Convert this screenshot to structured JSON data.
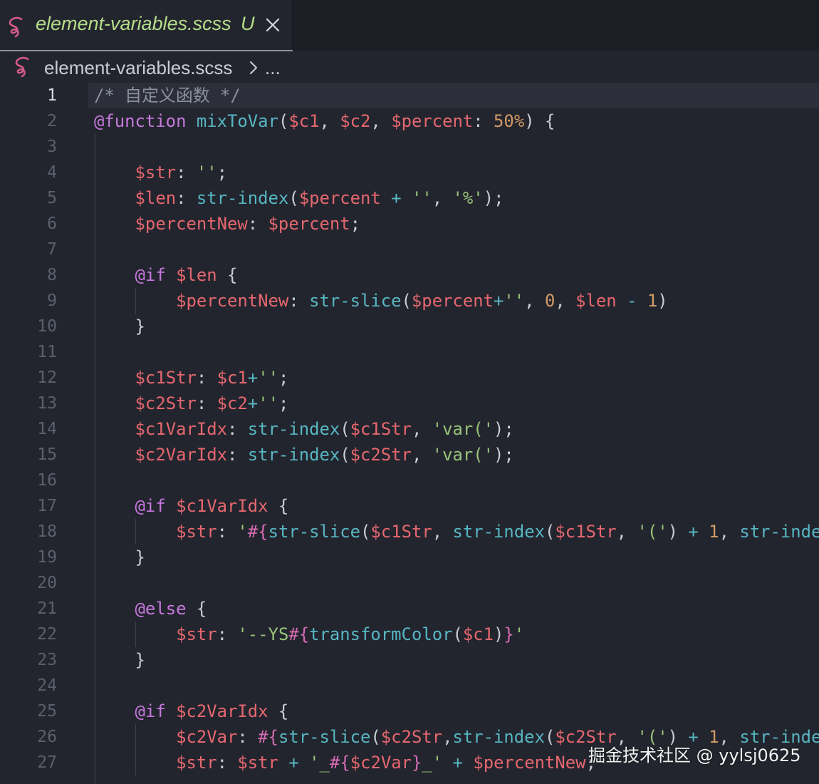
{
  "tab": {
    "icon": "sass-icon",
    "title": "element-variables.scss",
    "status": "U",
    "close_icon": "close-icon"
  },
  "breadcrumb": {
    "icon": "sass-icon",
    "file": "element-variables.scss",
    "separator_icon": "chevron-right-icon",
    "more": "..."
  },
  "editor": {
    "current_line": 1,
    "colors": {
      "background": "#23252e",
      "comment": "#8b909b",
      "keyword": "#c678dd",
      "function": "#56b6c2",
      "variable": "#e5676f",
      "number": "#d19a66",
      "string": "#98c379",
      "interpolation": "#d46bb1",
      "tab_title": "#b5dd8a",
      "sass_icon": "#d25a86"
    },
    "lines": [
      {
        "num": "1",
        "tokens": [
          [
            "comment",
            "/* 自定义函数 */"
          ]
        ]
      },
      {
        "num": "2",
        "tokens": [
          [
            "at",
            "@function"
          ],
          [
            "punc",
            " "
          ],
          [
            "fn",
            "mixToVar"
          ],
          [
            "punc",
            "("
          ],
          [
            "var",
            "$c1"
          ],
          [
            "punc",
            ", "
          ],
          [
            "var",
            "$c2"
          ],
          [
            "punc",
            ", "
          ],
          [
            "var",
            "$percent"
          ],
          [
            "punc",
            ": "
          ],
          [
            "num",
            "50%"
          ],
          [
            "punc",
            ") {"
          ]
        ]
      },
      {
        "num": "3",
        "tokens": []
      },
      {
        "num": "4",
        "tokens": [
          [
            "punc",
            "    "
          ],
          [
            "var",
            "$str"
          ],
          [
            "punc",
            ": "
          ],
          [
            "str",
            "''"
          ],
          [
            "punc",
            ";"
          ]
        ]
      },
      {
        "num": "5",
        "tokens": [
          [
            "punc",
            "    "
          ],
          [
            "var",
            "$len"
          ],
          [
            "punc",
            ": "
          ],
          [
            "fn",
            "str-index"
          ],
          [
            "punc",
            "("
          ],
          [
            "var",
            "$percent"
          ],
          [
            "punc",
            " "
          ],
          [
            "op",
            "+"
          ],
          [
            "punc",
            " "
          ],
          [
            "str",
            "''"
          ],
          [
            "punc",
            ", "
          ],
          [
            "str",
            "'%'"
          ],
          [
            "punc",
            ");"
          ]
        ]
      },
      {
        "num": "6",
        "tokens": [
          [
            "punc",
            "    "
          ],
          [
            "var",
            "$percentNew"
          ],
          [
            "punc",
            ": "
          ],
          [
            "var",
            "$percent"
          ],
          [
            "punc",
            ";"
          ]
        ]
      },
      {
        "num": "7",
        "tokens": []
      },
      {
        "num": "8",
        "tokens": [
          [
            "punc",
            "    "
          ],
          [
            "at",
            "@if"
          ],
          [
            "punc",
            " "
          ],
          [
            "var",
            "$len"
          ],
          [
            "punc",
            " {"
          ]
        ]
      },
      {
        "num": "9",
        "tokens": [
          [
            "punc",
            "        "
          ],
          [
            "var",
            "$percentNew"
          ],
          [
            "punc",
            ": "
          ],
          [
            "fn",
            "str-slice"
          ],
          [
            "punc",
            "("
          ],
          [
            "var",
            "$percent"
          ],
          [
            "op",
            "+"
          ],
          [
            "str",
            "''"
          ],
          [
            "punc",
            ", "
          ],
          [
            "num",
            "0"
          ],
          [
            "punc",
            ", "
          ],
          [
            "var",
            "$len"
          ],
          [
            "punc",
            " "
          ],
          [
            "op",
            "-"
          ],
          [
            "punc",
            " "
          ],
          [
            "num",
            "1"
          ],
          [
            "punc",
            ")"
          ]
        ]
      },
      {
        "num": "10",
        "tokens": [
          [
            "punc",
            "    }"
          ]
        ]
      },
      {
        "num": "11",
        "tokens": []
      },
      {
        "num": "12",
        "tokens": [
          [
            "punc",
            "    "
          ],
          [
            "var",
            "$c1Str"
          ],
          [
            "punc",
            ": "
          ],
          [
            "var",
            "$c1"
          ],
          [
            "op",
            "+"
          ],
          [
            "str",
            "''"
          ],
          [
            "punc",
            ";"
          ]
        ]
      },
      {
        "num": "13",
        "tokens": [
          [
            "punc",
            "    "
          ],
          [
            "var",
            "$c2Str"
          ],
          [
            "punc",
            ": "
          ],
          [
            "var",
            "$c2"
          ],
          [
            "op",
            "+"
          ],
          [
            "str",
            "''"
          ],
          [
            "punc",
            ";"
          ]
        ]
      },
      {
        "num": "14",
        "tokens": [
          [
            "punc",
            "    "
          ],
          [
            "var",
            "$c1VarIdx"
          ],
          [
            "punc",
            ": "
          ],
          [
            "fn",
            "str-index"
          ],
          [
            "punc",
            "("
          ],
          [
            "var",
            "$c1Str"
          ],
          [
            "punc",
            ", "
          ],
          [
            "str",
            "'var('"
          ],
          [
            "punc",
            ");"
          ]
        ]
      },
      {
        "num": "15",
        "tokens": [
          [
            "punc",
            "    "
          ],
          [
            "var",
            "$c2VarIdx"
          ],
          [
            "punc",
            ": "
          ],
          [
            "fn",
            "str-index"
          ],
          [
            "punc",
            "("
          ],
          [
            "var",
            "$c2Str"
          ],
          [
            "punc",
            ", "
          ],
          [
            "str",
            "'var('"
          ],
          [
            "punc",
            ");"
          ]
        ]
      },
      {
        "num": "16",
        "tokens": []
      },
      {
        "num": "17",
        "tokens": [
          [
            "punc",
            "    "
          ],
          [
            "at",
            "@if"
          ],
          [
            "punc",
            " "
          ],
          [
            "var",
            "$c1VarIdx"
          ],
          [
            "punc",
            " {"
          ]
        ]
      },
      {
        "num": "18",
        "tokens": [
          [
            "punc",
            "        "
          ],
          [
            "var",
            "$str"
          ],
          [
            "punc",
            ": "
          ],
          [
            "str",
            "'"
          ],
          [
            "interp",
            "#{"
          ],
          [
            "fn",
            "str-slice"
          ],
          [
            "punc",
            "("
          ],
          [
            "var",
            "$c1Str"
          ],
          [
            "punc",
            ", "
          ],
          [
            "fn",
            "str-index"
          ],
          [
            "punc",
            "("
          ],
          [
            "var",
            "$c1Str"
          ],
          [
            "punc",
            ", "
          ],
          [
            "str",
            "'('"
          ],
          [
            "punc",
            ") "
          ],
          [
            "op",
            "+"
          ],
          [
            "punc",
            " "
          ],
          [
            "num",
            "1"
          ],
          [
            "punc",
            ", "
          ],
          [
            "fn",
            "str-inde"
          ]
        ]
      },
      {
        "num": "19",
        "tokens": [
          [
            "punc",
            "    }"
          ]
        ]
      },
      {
        "num": "20",
        "tokens": []
      },
      {
        "num": "21",
        "tokens": [
          [
            "punc",
            "    "
          ],
          [
            "at",
            "@else"
          ],
          [
            "punc",
            " {"
          ]
        ]
      },
      {
        "num": "22",
        "tokens": [
          [
            "punc",
            "        "
          ],
          [
            "var",
            "$str"
          ],
          [
            "punc",
            ": "
          ],
          [
            "str",
            "'--YS"
          ],
          [
            "interp",
            "#{"
          ],
          [
            "fn",
            "transformColor"
          ],
          [
            "punc",
            "("
          ],
          [
            "var",
            "$c1"
          ],
          [
            "punc",
            ")"
          ],
          [
            "interp",
            "}"
          ],
          [
            "str",
            "'"
          ]
        ]
      },
      {
        "num": "23",
        "tokens": [
          [
            "punc",
            "    }"
          ]
        ]
      },
      {
        "num": "24",
        "tokens": []
      },
      {
        "num": "25",
        "tokens": [
          [
            "punc",
            "    "
          ],
          [
            "at",
            "@if"
          ],
          [
            "punc",
            " "
          ],
          [
            "var",
            "$c2VarIdx"
          ],
          [
            "punc",
            " {"
          ]
        ]
      },
      {
        "num": "26",
        "tokens": [
          [
            "punc",
            "        "
          ],
          [
            "var",
            "$c2Var"
          ],
          [
            "punc",
            ": "
          ],
          [
            "interp",
            "#{"
          ],
          [
            "fn",
            "str-slice"
          ],
          [
            "punc",
            "("
          ],
          [
            "var",
            "$c2Str"
          ],
          [
            "punc",
            ","
          ],
          [
            "fn",
            "str-index"
          ],
          [
            "punc",
            "("
          ],
          [
            "var",
            "$c2Str"
          ],
          [
            "punc",
            ", "
          ],
          [
            "str",
            "'('"
          ],
          [
            "punc",
            ") "
          ],
          [
            "op",
            "+"
          ],
          [
            "punc",
            " "
          ],
          [
            "num",
            "1"
          ],
          [
            "punc",
            ", "
          ],
          [
            "fn",
            "str-inde"
          ]
        ]
      },
      {
        "num": "27",
        "tokens": [
          [
            "punc",
            "        "
          ],
          [
            "var",
            "$str"
          ],
          [
            "punc",
            ": "
          ],
          [
            "var",
            "$str"
          ],
          [
            "punc",
            " "
          ],
          [
            "op",
            "+"
          ],
          [
            "punc",
            " "
          ],
          [
            "str",
            "'_"
          ],
          [
            "interp",
            "#{"
          ],
          [
            "var",
            "$c2Var"
          ],
          [
            "interp",
            "}"
          ],
          [
            "str",
            "_'"
          ],
          [
            "punc",
            " "
          ],
          [
            "op",
            "+"
          ],
          [
            "punc",
            " "
          ],
          [
            "var",
            "$percentNew"
          ],
          [
            "punc",
            ";"
          ]
        ]
      }
    ]
  },
  "watermark": {
    "text": "掘金技术社区 @ yylsj0625"
  }
}
